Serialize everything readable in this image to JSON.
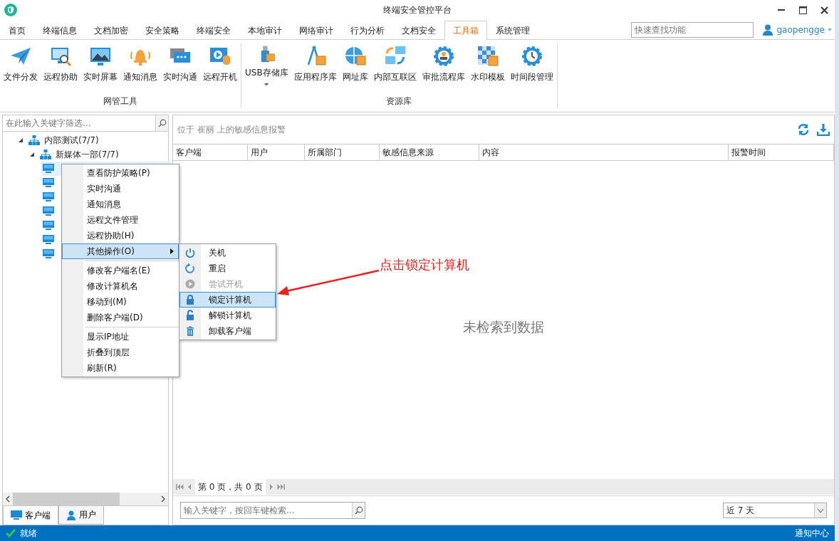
{
  "window": {
    "title": "终端安全管控平台"
  },
  "tabs": [
    {
      "label": "首页",
      "selected": false
    },
    {
      "label": "终端信息",
      "selected": false
    },
    {
      "label": "文档加密",
      "selected": false
    },
    {
      "label": "安全策略",
      "selected": false
    },
    {
      "label": "终端安全",
      "selected": false
    },
    {
      "label": "本地审计",
      "selected": false
    },
    {
      "label": "网络审计",
      "selected": false
    },
    {
      "label": "行为分析",
      "selected": false
    },
    {
      "label": "文档安全",
      "selected": false
    },
    {
      "label": "工具箱",
      "selected": true
    },
    {
      "label": "系统管理",
      "selected": false
    }
  ],
  "quick_search": {
    "placeholder": "快速查找功能"
  },
  "user": {
    "name": "gaopengge"
  },
  "ribbon": [
    {
      "label": "网管工具",
      "tools": [
        {
          "label": "文件分发",
          "dropdown": false
        },
        {
          "label": "远程协助",
          "dropdown": false
        },
        {
          "label": "实时屏幕",
          "dropdown": false
        },
        {
          "label": "通知消息",
          "dropdown": false
        },
        {
          "label": "实时沟通",
          "dropdown": false
        },
        {
          "label": "远程开机",
          "dropdown": false
        }
      ]
    },
    {
      "label": "资源库",
      "tools": [
        {
          "label": "USB存储库",
          "dropdown": true
        },
        {
          "label": "应用程序库",
          "dropdown": false
        },
        {
          "label": "网址库",
          "dropdown": false
        },
        {
          "label": "内部互联区",
          "dropdown": false
        },
        {
          "label": "审批流程库",
          "dropdown": false
        },
        {
          "label": "水印模板",
          "dropdown": false
        },
        {
          "label": "时间段管理",
          "dropdown": false
        }
      ]
    }
  ],
  "sidebar": {
    "filter": {
      "placeholder": "在此输入关键字筛选..."
    },
    "tree": [
      {
        "label": "内部测试(7/7)",
        "expanded": true,
        "children": [
          {
            "label": "新媒体一部(7/7)",
            "expanded": true,
            "children": [
              {
                "selected": true
              },
              {
                "selected": false
              },
              {
                "selected": false
              },
              {
                "selected": false
              },
              {
                "selected": false
              },
              {
                "selected": false
              },
              {
                "selected": false
              }
            ]
          }
        ]
      }
    ],
    "bottom_tabs": [
      {
        "label": "客户端",
        "selected": true
      },
      {
        "label": "用户",
        "selected": false
      }
    ]
  },
  "context_menu": {
    "groups": [
      [
        {
          "label": "查看防护策略(P)",
          "selected": false,
          "submenu": false
        },
        {
          "label": "实时沟通",
          "selected": false,
          "submenu": false
        },
        {
          "label": "通知消息",
          "selected": false,
          "submenu": false
        },
        {
          "label": "远程文件管理",
          "selected": false,
          "submenu": false
        },
        {
          "label": "远程协助(H)",
          "selected": false,
          "submenu": false
        },
        {
          "label": "其他操作(O)",
          "selected": true,
          "submenu": true
        }
      ],
      [
        {
          "label": "修改客户端名(E)",
          "selected": false,
          "submenu": false
        },
        {
          "label": "修改计算机名",
          "selected": false,
          "submenu": false
        },
        {
          "label": "移动到(M)",
          "selected": false,
          "submenu": false
        },
        {
          "label": "删除客户端(D)",
          "selected": false,
          "submenu": false
        }
      ],
      [
        {
          "label": "显示IP地址",
          "selected": false,
          "submenu": false
        },
        {
          "label": "折叠到顶层",
          "selected": false,
          "submenu": false
        },
        {
          "label": "刷新(R)",
          "selected": false,
          "submenu": false
        }
      ]
    ],
    "submenu": [
      {
        "label": "关机",
        "disabled": false,
        "selected": false
      },
      {
        "label": "重启",
        "disabled": false,
        "selected": false
      },
      {
        "label": "尝试开机",
        "disabled": true,
        "selected": false
      },
      {
        "label": "锁定计算机",
        "disabled": false,
        "selected": true
      },
      {
        "label": "解锁计算机",
        "disabled": false,
        "selected": false
      },
      {
        "label": "卸载客户端",
        "disabled": false,
        "selected": false
      }
    ]
  },
  "annotation": {
    "text": "点击锁定计算机"
  },
  "panel": {
    "title": "位于 崔丽 上的敏感信息报警",
    "table": {
      "columns": [
        "客户端",
        "用户",
        "所属部门",
        "敏感信息来源",
        "内容",
        "报警时间"
      ],
      "empty_text": "未检索到数据"
    },
    "pager": {
      "text": "第 0 页，共 0 页"
    },
    "search": {
      "placeholder": "输入关键字，按回车键检索..."
    },
    "range": {
      "value": "近 7 天"
    }
  },
  "status_bar": {
    "text": "就绪",
    "right": "通知中心"
  }
}
